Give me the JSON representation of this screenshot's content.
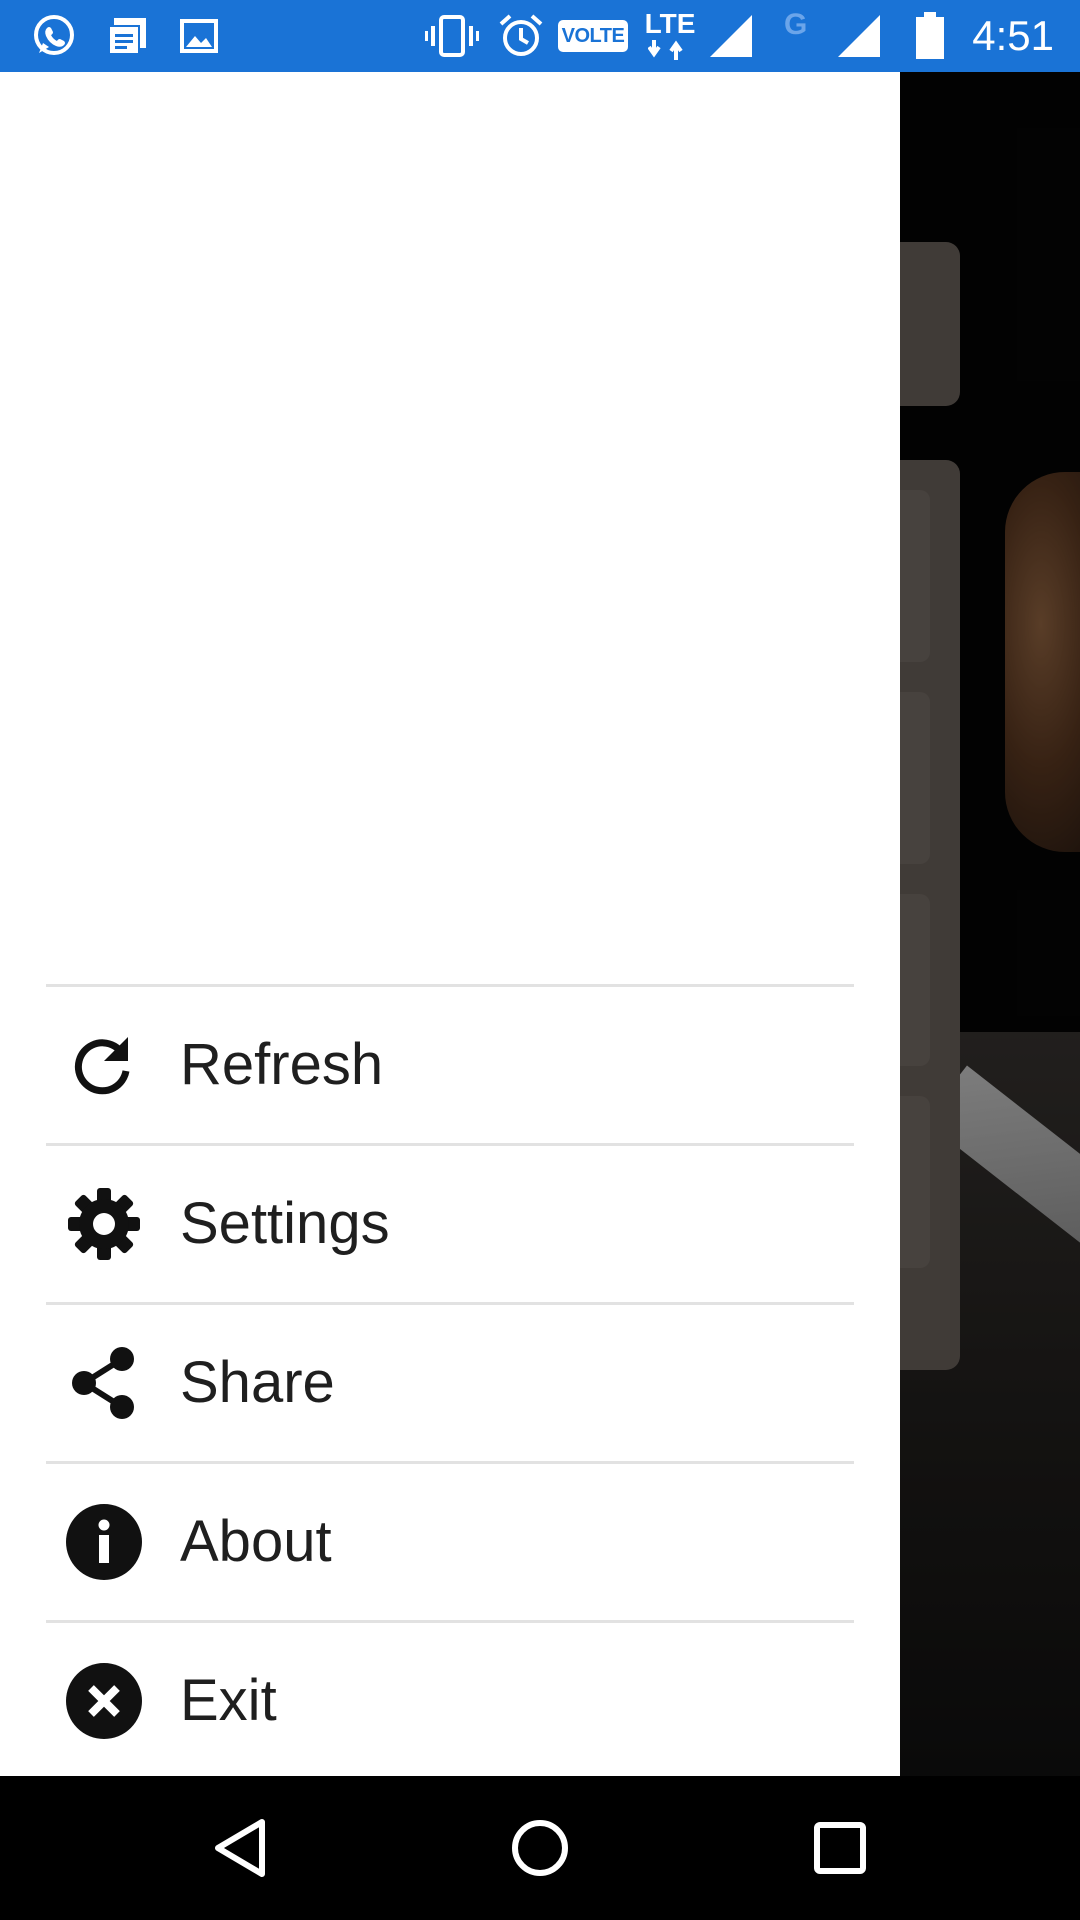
{
  "status_bar": {
    "time": "4:51",
    "volte_label": "VOLTE",
    "lte_label": "LTE",
    "g_label": "G",
    "left_icons": [
      "whatsapp-icon",
      "message-icon",
      "image-icon"
    ],
    "right_icons": [
      "vibrate-icon",
      "alarm-icon",
      "volte-badge",
      "lte-icon",
      "signal-icon",
      "g-icon",
      "signal-icon",
      "battery-icon"
    ]
  },
  "drawer": {
    "menu_items": [
      {
        "label": "Refresh",
        "icon": "refresh-icon"
      },
      {
        "label": "Settings",
        "icon": "gear-icon"
      },
      {
        "label": "Share",
        "icon": "share-icon"
      },
      {
        "label": "About",
        "icon": "info-icon"
      },
      {
        "label": "Exit",
        "icon": "close-circle-icon"
      }
    ]
  },
  "nav_bar": {
    "buttons": [
      "back-icon",
      "home-icon",
      "recents-icon"
    ]
  },
  "colors": {
    "status_bar": "#1a73d6",
    "drawer_background": "#ffffff",
    "menu_text": "#1f1f1f",
    "divider": "#e2e2e2",
    "nav_bar": "#000000"
  }
}
